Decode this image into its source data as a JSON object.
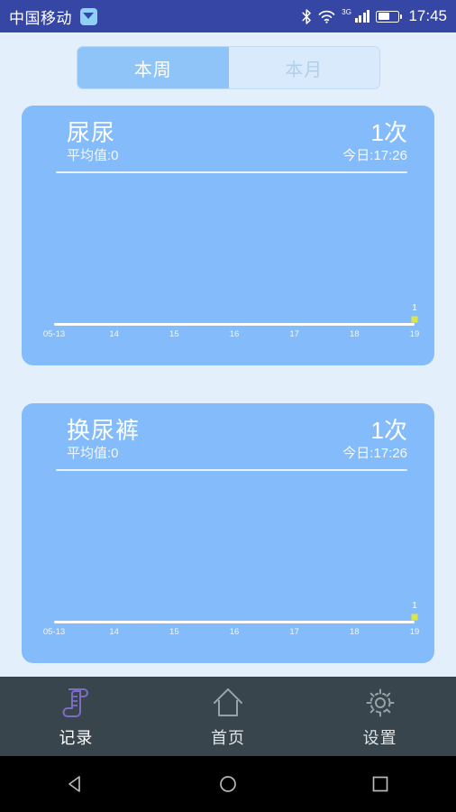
{
  "status_bar": {
    "carrier": "中国移动",
    "message_icon": "message-icon",
    "bluetooth_icon": "bluetooth-icon",
    "wifi_icon": "wifi-icon",
    "network_type": "3G",
    "signal_icon": "signal-bars-icon",
    "battery_icon": "battery-icon",
    "clock": "17:45",
    "background": "#3646a4"
  },
  "tabs": {
    "week_label": "本周",
    "month_label": "本月",
    "selected": "本周",
    "selected_bg": "#8fc4f8",
    "unselected_bg": "#d9eafc"
  },
  "cards": [
    {
      "title": "尿尿",
      "subtitle": "平均值:0",
      "count": "1次",
      "today": "今日:17:26"
    },
    {
      "title": "换尿裤",
      "subtitle": "平均值:0",
      "count": "1次",
      "today": "今日:17:26"
    }
  ],
  "chart_data": [
    {
      "type": "line",
      "title": "尿尿",
      "categories": [
        "05-13",
        "14",
        "15",
        "16",
        "17",
        "18",
        "19"
      ],
      "values": [
        0,
        0,
        0,
        0,
        0,
        0,
        1
      ],
      "point_labels": [
        "",
        "",
        "",
        "",
        "",
        "",
        "1"
      ],
      "xlabel": "",
      "ylabel": "",
      "ylim": [
        0,
        1
      ],
      "grid": false,
      "legend": "none",
      "marker_color": "#d8e84a",
      "axis_color": "#ffffff",
      "plot_bg": "#84bcfb"
    },
    {
      "type": "line",
      "title": "换尿裤",
      "categories": [
        "05-13",
        "14",
        "15",
        "16",
        "17",
        "18",
        "19"
      ],
      "values": [
        0,
        0,
        0,
        0,
        0,
        0,
        1
      ],
      "point_labels": [
        "",
        "",
        "",
        "",
        "",
        "",
        "1"
      ],
      "xlabel": "",
      "ylabel": "",
      "ylim": [
        0,
        1
      ],
      "grid": false,
      "legend": "none",
      "marker_color": "#d8e84a",
      "axis_color": "#ffffff",
      "plot_bg": "#84bcfb"
    }
  ],
  "bottom_nav": {
    "items": [
      {
        "label": "记录",
        "icon": "scroll-icon",
        "active": true
      },
      {
        "label": "首页",
        "icon": "home-icon",
        "active": false
      },
      {
        "label": "设置",
        "icon": "gear-icon",
        "active": false
      }
    ],
    "background": "#38454c",
    "active_color": "#7e6cc4"
  },
  "system_bar": {
    "back_icon": "back-triangle-icon",
    "home_icon": "home-circle-icon",
    "recents_icon": "recents-square-icon"
  },
  "page": {
    "background": "#e3f0fc",
    "card_background": "#84bcfb"
  }
}
